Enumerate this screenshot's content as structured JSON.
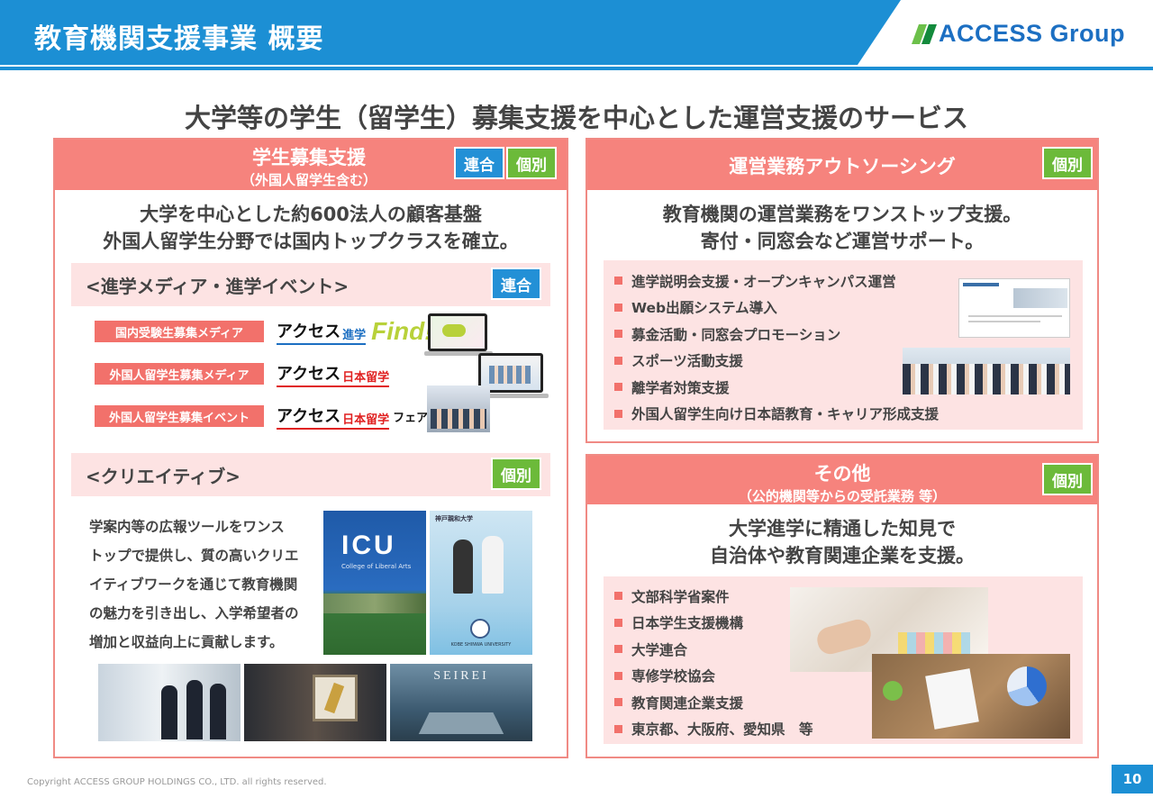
{
  "header": {
    "title": "教育機関支援事業 概要",
    "logo_text": "ACCESS Group",
    "brand_color": "#1c8fd4"
  },
  "subtitle": "大学等の学生（留学生）募集支援を中心とした運営支援のサービス",
  "left_panel": {
    "title": "学生募集支援",
    "subtitle": "（外国人留学生含む）",
    "tags": [
      "連合",
      "個別"
    ],
    "lead": [
      "大学を中心とした約600法人の顧客基盤",
      "外国人留学生分野では国内トップクラスを確立。"
    ],
    "media_section": {
      "label": "<進学メディア・進学イベント>",
      "tag": "連合",
      "rows": [
        {
          "label": "国内受験生募集メディア",
          "brand": "アクセス",
          "brand_sub": "進学",
          "extra": "Find!"
        },
        {
          "label": "外国人留学生募集メディア",
          "brand": "アクセス",
          "brand_sub": "日本留学",
          "extra": ""
        },
        {
          "label": "外国人留学生募集イベント",
          "brand": "アクセス",
          "brand_sub": "日本留学",
          "extra": "フェア"
        }
      ]
    },
    "creative_section": {
      "label": "<クリエイティブ>",
      "tag": "個別",
      "lines": [
        "学案内等の広報ツールをワンス",
        "トップで提供し、質の高いクリエ",
        "イティブワークを通じて教育機関",
        "の魅力を引き出し、入学希望者の",
        "増加と収益向上に貢献します。"
      ],
      "icu_text": "ICU",
      "icu_sub": "College of Liberal Arts",
      "kobe_text": "神戸親和大学",
      "kobe_sub": "KOBE SHINWA UNIVERSITY",
      "seirei_text": "SEIREI"
    }
  },
  "right_top_panel": {
    "title": "運営業務アウトソーシング",
    "tag": "個別",
    "lead": [
      "教育機関の運営業務をワンストップ支援。",
      "寄付・同窓会など運営サポート。"
    ],
    "bullets": [
      "進学説明会支援・オープンキャンパス運営",
      "Web出願システム導入",
      "募金活動・同窓会プロモーション",
      "スポーツ活動支援",
      "離学者対策支援",
      "外国人留学生向け日本語教育・キャリア形成支援"
    ]
  },
  "right_bottom_panel": {
    "title": "その他",
    "subtitle": "（公的機関等からの受託業務 等）",
    "tag": "個別",
    "lead": [
      "大学進学に精通した知見で",
      "自治体や教育関連企業を支援。"
    ],
    "bullets": [
      "文部科学省案件",
      "日本学生支援機構",
      "大学連合",
      "専修学校協会",
      "教育関連企業支援",
      "東京都、大阪府、愛知県　等"
    ]
  },
  "footer": {
    "copyright": "Copyright ACCESS GROUP HOLDINGS CO., LTD. all rights reserved.",
    "page": "10"
  }
}
